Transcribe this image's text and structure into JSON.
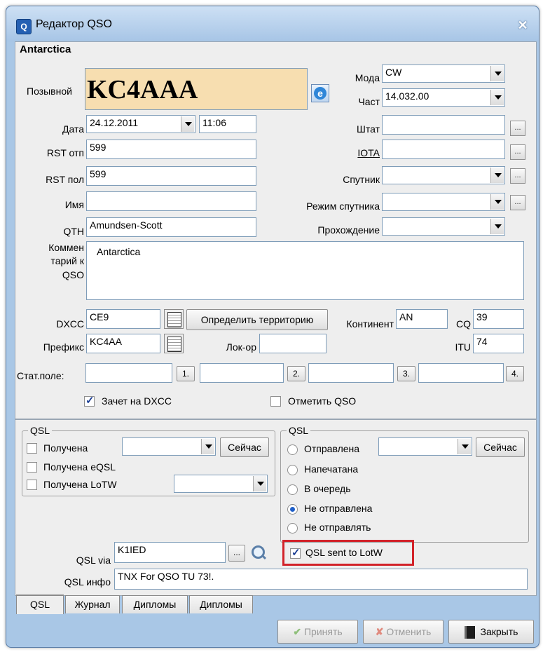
{
  "window": {
    "title": "Редактор QSO",
    "subtitle": "Antarctica"
  },
  "main": {
    "callsign_label": "Позывной",
    "callsign": "KC4AAA",
    "mode_label": "Мода",
    "mode": "CW",
    "freq_label": "Част",
    "freq": "14.032.00",
    "date_label": "Дата",
    "date": "24.12.2011",
    "time": "11:06",
    "rst_sent_label": "RST отп",
    "rst_sent": "599",
    "rst_rcvd_label": "RST пол",
    "rst_rcvd": "599",
    "name_label": "Имя",
    "name": "",
    "qth_label": "QTH",
    "qth": "Amundsen-Scott",
    "state_label": "Штат",
    "state": "",
    "iota_label": "IOTA",
    "iota": "",
    "satellite_label": "Спутник",
    "satellite": "",
    "sat_mode_label": "Режим спутника",
    "sat_mode": "",
    "propagation_label": "Прохождение",
    "propagation": "",
    "comment_label_1": "Коммен",
    "comment_label_2": "тарий к",
    "comment_label_3": "QSO",
    "comment": "Antarctica",
    "dxcc_label": "DXCC",
    "dxcc": "CE9",
    "determine_territory": "Определить территорию",
    "continent_label": "Континент",
    "continent": "AN",
    "cq_label": "CQ",
    "cq": "39",
    "prefix_label": "Префикс",
    "prefix": "KC4AA",
    "locator_label": "Лок-ор",
    "locator": "",
    "itu_label": "ITU",
    "itu": "74",
    "stat_label": "Стат.поле:",
    "stat_btn_1": "1.",
    "stat_btn_2": "2.",
    "stat_btn_3": "3.",
    "stat_btn_4": "4.",
    "dxcc_credit_label": "Зачет на DXCC",
    "mark_qso_label": "Отметить QSO"
  },
  "qsl_received": {
    "title": "QSL",
    "received": "Получена",
    "now": "Сейчас",
    "received_eqsl": "Получена eQSL",
    "received_lotw": "Получена LoTW"
  },
  "qsl_sent": {
    "title": "QSL",
    "sent": "Отправлена",
    "now": "Сейчас",
    "printed": "Напечатана",
    "queued": "В очередь",
    "not_sent": "Не отправлена",
    "dont_send": "Не отправлять",
    "lotw_sent": "QSL sent to LotW"
  },
  "qsl_via": {
    "label": "QSL via",
    "value": "K1IED",
    "dots": "..."
  },
  "qsl_info": {
    "label": "QSL инфо",
    "value": "TNX For QSO TU 73!."
  },
  "tabs": [
    "QSL",
    "Журнал",
    "Дипломы",
    "Дипломы"
  ],
  "buttons": {
    "accept": "Принять",
    "cancel": "Отменить",
    "close": "Закрыть"
  },
  "colors": {
    "callsign_bg": "#f7deb0",
    "highlight_box": "#d2232a"
  }
}
